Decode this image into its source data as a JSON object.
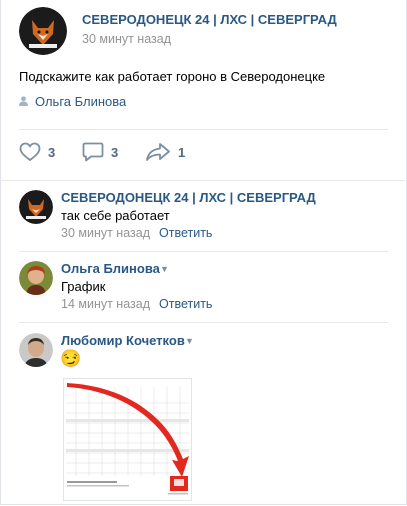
{
  "post": {
    "group_name": "СЕВЕРОДОНЕЦК 24 | ЛХС | СЕВЕРГРАД",
    "time": "30 минут назад",
    "text": "Подскажите как работает гороно в Северодонецке",
    "signer": "Ольга Блинова",
    "likes": "3",
    "comments": "3",
    "shares": "1"
  },
  "comments": [
    {
      "author": "СЕВЕРОДОНЕЦК 24 | ЛХС | СЕВЕРГРАД",
      "text": "так себе работает",
      "time": "30 минут назад",
      "reply": "Ответить"
    },
    {
      "author": "Ольга Блинова",
      "text": "График",
      "time": "14 минут назад",
      "reply": "Ответить"
    },
    {
      "author": "Любомир Кочетков",
      "emoji": "😏"
    }
  ],
  "colors": {
    "link": "#2a5885",
    "meta": "#939393",
    "action": "#55677d",
    "arrow": "#e3291f"
  }
}
